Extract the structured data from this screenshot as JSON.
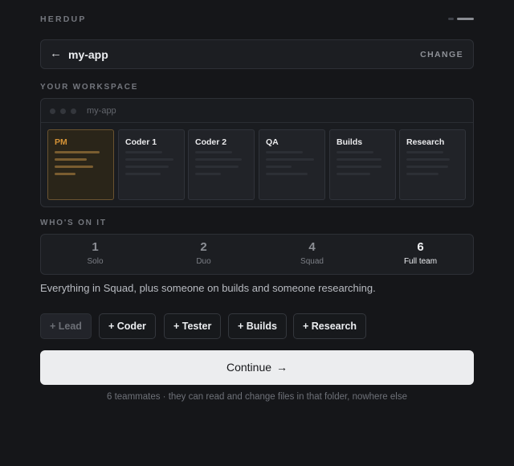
{
  "brand": "HERDUP",
  "progress": {
    "step": 2,
    "total": 2
  },
  "folder": {
    "back_icon": "←",
    "name": "my-app",
    "change_label": "CHANGE"
  },
  "workspace": {
    "label": "YOUR WORKSPACE",
    "window_title": "my-app",
    "panes": [
      {
        "title": "PM",
        "active": true
      },
      {
        "title": "Coder 1",
        "active": false
      },
      {
        "title": "Coder 2",
        "active": false
      },
      {
        "title": "QA",
        "active": false
      },
      {
        "title": "Builds",
        "active": false
      },
      {
        "title": "Research",
        "active": false
      }
    ]
  },
  "team": {
    "label": "WHO'S ON IT",
    "options": [
      {
        "count": "1",
        "name": "Solo",
        "selected": false
      },
      {
        "count": "2",
        "name": "Duo",
        "selected": false
      },
      {
        "count": "4",
        "name": "Squad",
        "selected": false
      },
      {
        "count": "6",
        "name": "Full team",
        "selected": true
      }
    ],
    "description": "Everything in Squad, plus someone on builds and someone researching."
  },
  "roles": [
    {
      "label": "+ Lead",
      "muted": true
    },
    {
      "label": "+ Coder",
      "muted": false
    },
    {
      "label": "+ Tester",
      "muted": false
    },
    {
      "label": "+ Builds",
      "muted": false
    },
    {
      "label": "+ Research",
      "muted": false
    }
  ],
  "continue": {
    "label": "Continue",
    "arrow": "→"
  },
  "footnote": "6 teammates · they can read and change files in that folder, nowhere else",
  "colors": {
    "background": "#151619",
    "accent": "#d69437",
    "button": "#ecedef"
  }
}
